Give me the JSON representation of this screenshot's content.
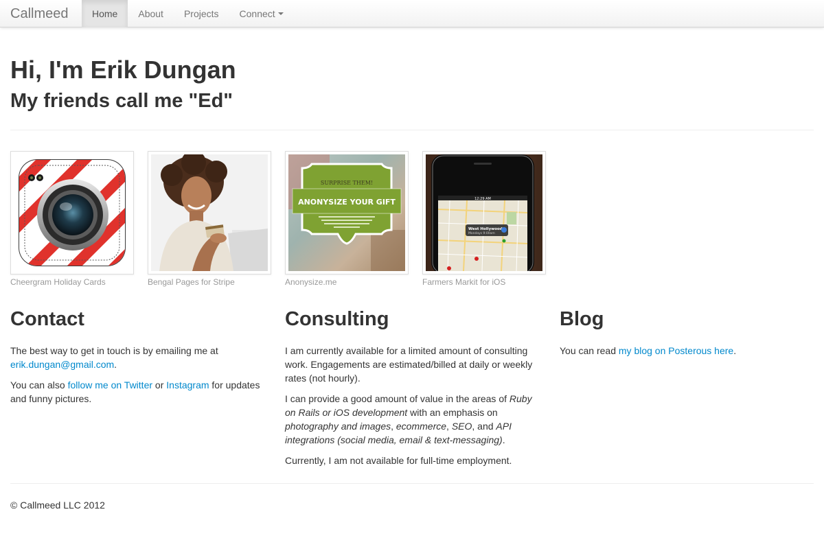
{
  "navbar": {
    "brand": "Callmeed",
    "items": [
      {
        "label": "Home",
        "active": true
      },
      {
        "label": "About"
      },
      {
        "label": "Projects"
      },
      {
        "label": "Connect",
        "dropdown": true
      }
    ]
  },
  "hero": {
    "title": "Hi, I'm Erik Dungan",
    "subtitle": "My friends call me \"Ed\""
  },
  "projects": [
    {
      "caption": "Cheergram Holiday Cards",
      "icon": "camera-app-icon"
    },
    {
      "caption": "Bengal Pages for Stripe",
      "icon": "woman-with-credit-card-photo"
    },
    {
      "caption": "Anonysize.me",
      "icon": "gift-badge-image",
      "image_text": {
        "top": "SURPRISE THEM!",
        "main": "ANONYSIZE YOUR GIFT"
      }
    },
    {
      "caption": "Farmers Markit for iOS",
      "icon": "iphone-map-screenshot",
      "image_text": {
        "time": "12:29 AM",
        "pin_title": "West Hollywood",
        "pin_sub": "Mondays 9:00am"
      }
    }
  ],
  "contact": {
    "heading": "Contact",
    "p1_text": "The best way to get in touch is by emailing me at ",
    "email_link": "erik.dungan@gmail.com",
    "p1_end": ".",
    "p2_text": "You can also ",
    "twitter_link": "follow me on Twitter",
    "p2_or": " or ",
    "instagram_link": "Instagram",
    "p2_end": " for updates and funny pictures."
  },
  "consulting": {
    "heading": "Consulting",
    "p1": "I am currently available for a limited amount of consulting work. Engagements are estimated/billed at daily or weekly rates (not hourly).",
    "p2_a": "I can provide a good amount of value in the areas of ",
    "p2_em1": "Ruby on Rails or iOS development",
    "p2_b": " with an emphasis on ",
    "p2_em2": "photography and images",
    "p2_c": ", ",
    "p2_em3": "ecommerce",
    "p2_d": ", ",
    "p2_em4": "SEO",
    "p2_e": ", and ",
    "p2_em5": "API integrations (social media, email & text-messaging)",
    "p2_f": ".",
    "p3": "Currently, I am not available for full-time employment."
  },
  "blog": {
    "heading": "Blog",
    "text": "You can read ",
    "link": "my blog on Posterous here",
    "end": "."
  },
  "footer": {
    "text": "© Callmeed LLC 2012"
  },
  "colors": {
    "link": "#0088cc",
    "text": "#333333",
    "muted": "#999999",
    "nav_text": "#777777"
  }
}
